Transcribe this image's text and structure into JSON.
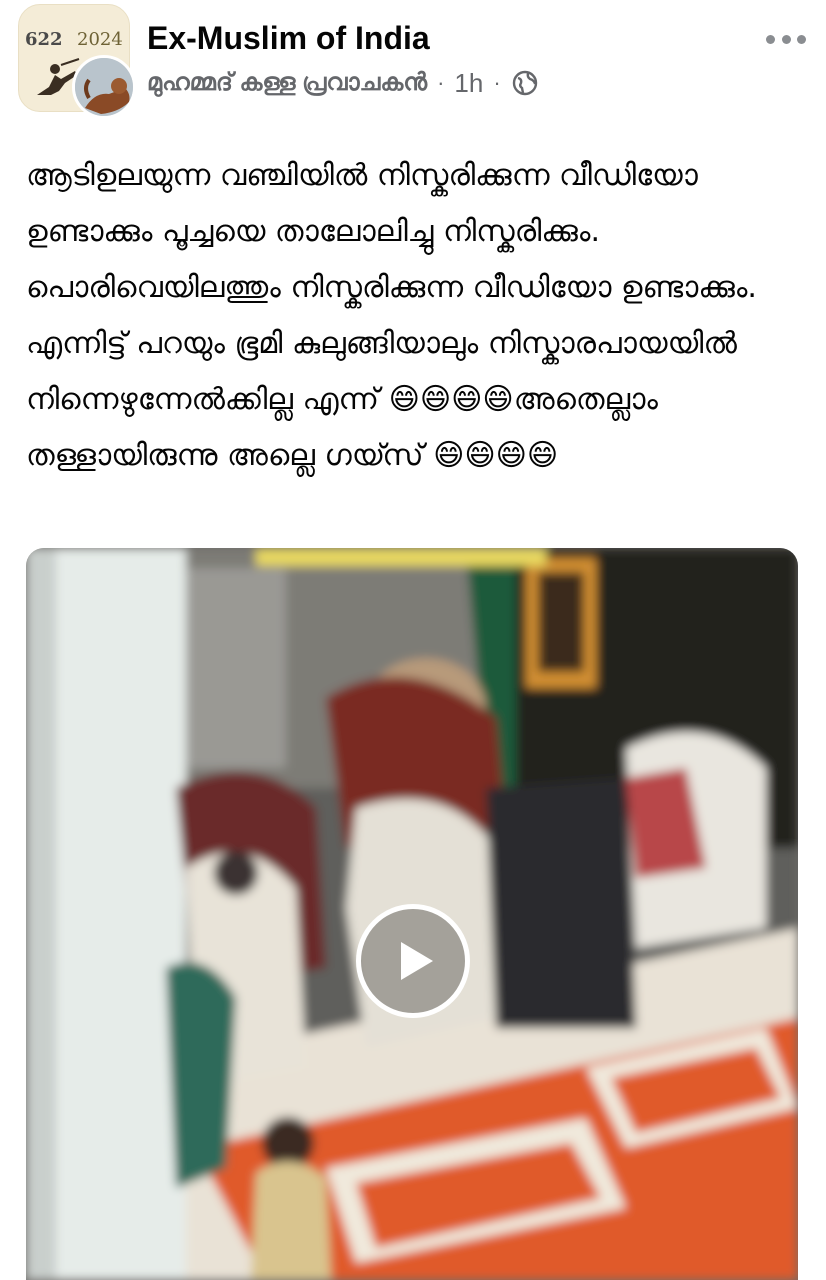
{
  "header": {
    "group_avatar": {
      "year_left": "622",
      "year_right": "2024"
    },
    "group_name": "Ex-Muslim of India",
    "author_name": "മുഹമ്മദ് കള്ള പ്രവാചകൻ",
    "separator": "·",
    "time": "1h",
    "privacy_icon": "globe-icon",
    "menu_icon": "more-options-icon"
  },
  "post": {
    "text": "ആടിഉലയുന്ന വഞ്ചിയിൽ നിസ്കരിക്കുന്ന വീഡിയോ ഉണ്ടാക്കും പൂച്ചയെ താലോലിച്ചു നിസ്കരിക്കും. പൊരിവെയിലത്തും നിസ്കരിക്കുന്ന വീഡിയോ ഉണ്ടാക്കും. എന്നിട്ട് പറയും ഭൂമി കുലുങ്ങിയാലും നിസ്കാരപായയിൽ നിന്നെഴുന്നേൽക്കില്ല എന്ന് 😄😄😄😄അതെല്ലാം തള്ളായിരുന്നു അല്ലെ ഗയ്സ് 😄😄😄😄"
  },
  "video": {
    "play_icon": "play-icon",
    "colors": {
      "carpet": "#e05a2c",
      "carpet_border": "#e9e2d6",
      "pillar": "#e6ece9",
      "wall": "#3b3f3c"
    }
  }
}
